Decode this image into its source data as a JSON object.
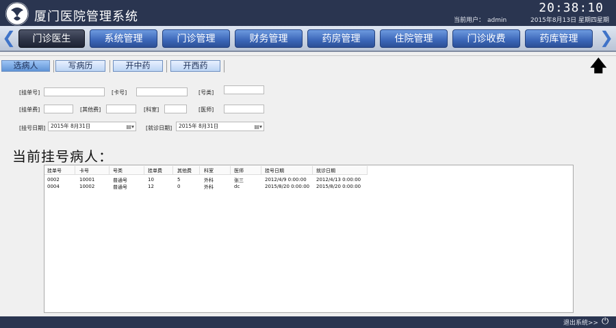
{
  "header": {
    "app_title": "厦门医院管理系统",
    "clock": "20:38:10",
    "user_label": "当前用户：",
    "user_name": "admin",
    "date_text": "2015年8月13日 星期四星期"
  },
  "nav": {
    "left_arrow": "❮",
    "right_arrow": "❯",
    "tabs": [
      {
        "label": "门诊医生",
        "active": true
      },
      {
        "label": "系统管理"
      },
      {
        "label": "门诊管理"
      },
      {
        "label": "财务管理"
      },
      {
        "label": "药房管理"
      },
      {
        "label": "住院管理"
      },
      {
        "label": "门诊收费"
      },
      {
        "label": "药库管理"
      }
    ]
  },
  "toolbar": {
    "buttons": [
      "选病人",
      "写病历",
      "开中药",
      "开西药"
    ],
    "up_arrow": "🡅"
  },
  "form": {
    "reg_no_label": "[挂单号]",
    "card_no_label": "[卡号]",
    "type_label": "[号类]",
    "reg_fee_label": "[挂单费]",
    "other_fee_label": "[其他费]",
    "dept_label": "[科室]",
    "doctor_label": "[医师]",
    "reg_date_label": "[挂号日期]",
    "reg_date_value": "2015年  8月31日",
    "visit_date_label": "[就诊日期]",
    "visit_date_value": "2015年  8月31日",
    "reg_no_value": "",
    "card_no_value": "",
    "type_value": "",
    "reg_fee_value": "",
    "other_fee_value": "",
    "dept_value": "",
    "doctor_value": ""
  },
  "section_title": "当前挂号病人：",
  "table": {
    "columns": [
      "挂单号",
      "卡号",
      "号类",
      "挂单费",
      "其他费",
      "科室",
      "医师",
      "挂号日期",
      "就诊日期"
    ],
    "rows": [
      [
        "0002",
        "10001",
        "普通号",
        "10",
        "5",
        "外科",
        "张三",
        "2012/4/9 0:00:00",
        "2012/4/13 0:00:00"
      ],
      [
        "0004",
        "10002",
        "普通号",
        "12",
        "0",
        "外科",
        "dc",
        "2015/8/20 0:00:00",
        "2015/8/20 0:00:00"
      ]
    ]
  },
  "status": {
    "logout_label": "退出系统>>",
    "power_icon": "⏻"
  },
  "colors": {
    "header_bg": "#2a3550",
    "tab_blue": "#3b66b8",
    "tab_active": "#2c3245"
  }
}
